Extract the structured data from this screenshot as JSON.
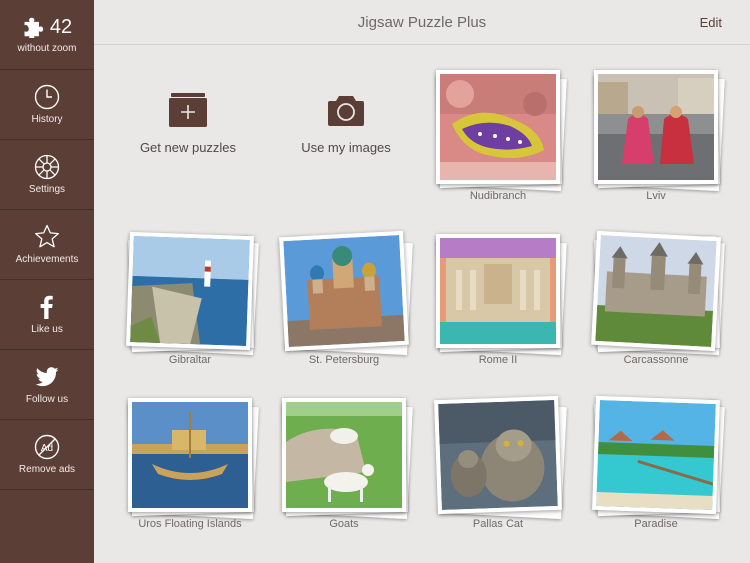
{
  "header": {
    "title": "Jigsaw Puzzle Plus",
    "edit_label": "Edit"
  },
  "sidebar": {
    "counter": {
      "value": "42",
      "label": "without zoom",
      "icon": "puzzle-piece-icon"
    },
    "items": [
      {
        "label": "History",
        "icon": "clock-icon"
      },
      {
        "label": "Settings",
        "icon": "gear-icon"
      },
      {
        "label": "Achievements",
        "icon": "star-icon"
      },
      {
        "label": "Like us",
        "icon": "facebook-icon"
      },
      {
        "label": "Follow us",
        "icon": "twitter-icon"
      },
      {
        "label": "Remove ads",
        "icon": "no-ads-icon"
      }
    ]
  },
  "actions": [
    {
      "label": "Get new puzzles",
      "icon": "add-folder-icon"
    },
    {
      "label": "Use my images",
      "icon": "camera-icon"
    }
  ],
  "puzzles": [
    {
      "name": "Nudibranch"
    },
    {
      "name": "Lviv"
    },
    {
      "name": "Gibraltar"
    },
    {
      "name": "St. Petersburg"
    },
    {
      "name": "Rome II"
    },
    {
      "name": "Carcassonne"
    },
    {
      "name": "Uros Floating Islands"
    },
    {
      "name": "Goats"
    },
    {
      "name": "Pallas Cat"
    },
    {
      "name": "Paradise"
    }
  ],
  "colors": {
    "sidebar": "#5b3e36",
    "background": "#e9e8e6",
    "accent": "#5b3e36"
  }
}
